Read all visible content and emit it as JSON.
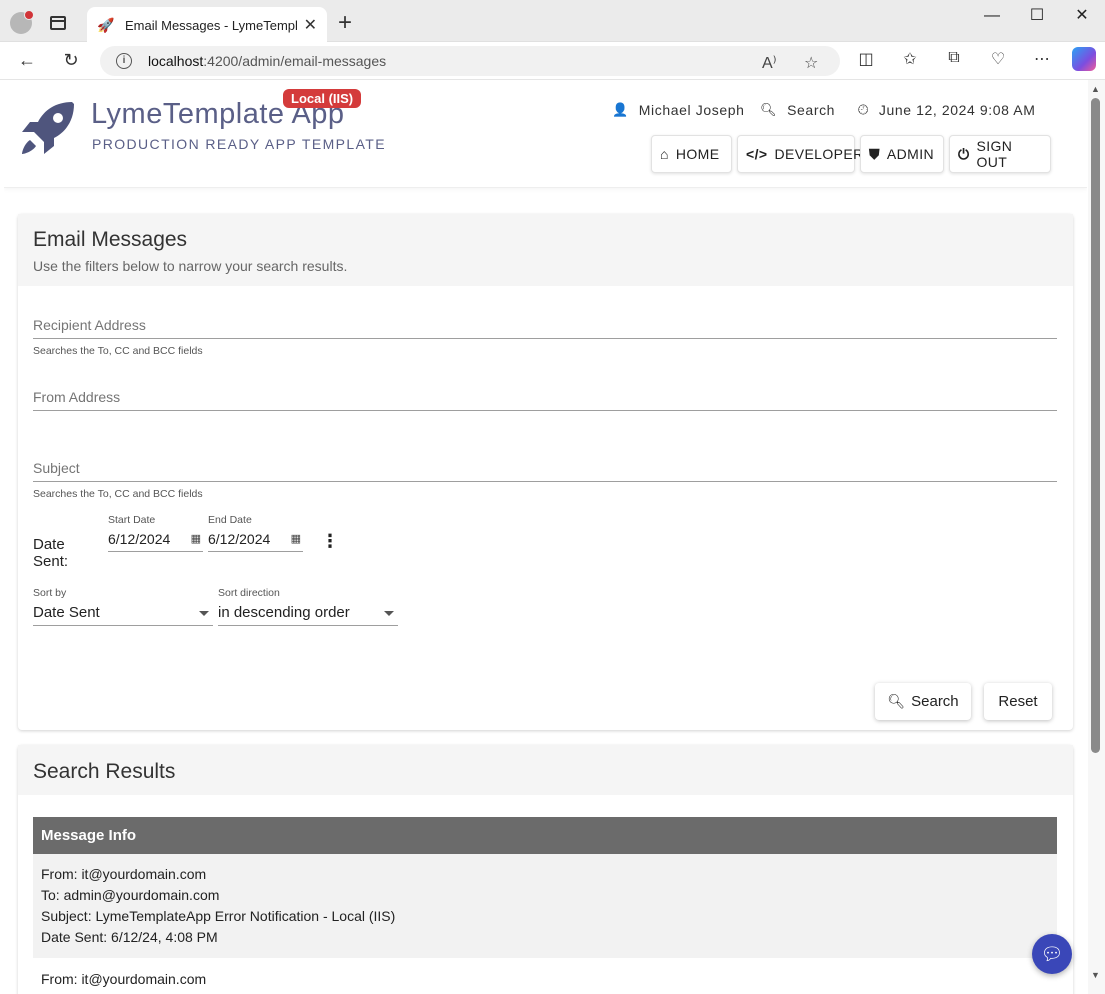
{
  "browser": {
    "tab_title": "Email Messages - LymeTemplate",
    "tab_close": "✕",
    "new_tab": "+",
    "url_host": "localhost",
    "url_path": ":4200/admin/email-messages",
    "window_controls": {
      "minimize": "—",
      "maximize": "☐",
      "close": "✕"
    }
  },
  "header": {
    "app_title": "LymeTemplate App",
    "app_subtitle": "PRODUCTION READY APP TEMPLATE",
    "env_badge": "Local (IIS)",
    "user_name": "Michael Joseph",
    "search_label": "Search",
    "datetime": "June 12, 2024 9:08 AM",
    "nav": {
      "home": "HOME",
      "developer": "DEVELOPER",
      "admin": "ADMIN",
      "sign_out": "SIGN OUT"
    }
  },
  "filters": {
    "title": "Email Messages",
    "description": "Use the filters below to narrow your search results.",
    "recipient_label": "Recipient Address",
    "recipient_hint": "Searches the To, CC and BCC fields",
    "from_label": "From Address",
    "subject_label": "Subject",
    "subject_hint": "Searches the To, CC and BCC fields",
    "date_sent_label": "Date Sent:",
    "start_date_label": "Start Date",
    "start_date_value": "6/12/2024",
    "end_date_label": "End Date",
    "end_date_value": "6/12/2024",
    "sort_by_label": "Sort by",
    "sort_by_value": "Date Sent",
    "sort_dir_label": "Sort direction",
    "sort_dir_value": "in descending order",
    "search_button": "Search",
    "reset_button": "Reset"
  },
  "results": {
    "title": "Search Results",
    "column_header": "Message Info",
    "rows": [
      {
        "from": "From: it@yourdomain.com",
        "to": "To: admin@yourdomain.com",
        "subject": "Subject: LymeTemplateApp Error Notification - Local (IIS)",
        "date": "Date Sent: 6/12/24, 4:08 PM"
      },
      {
        "from": "From: it@yourdomain.com"
      }
    ]
  },
  "colors": {
    "brand": "#5a5f87",
    "badge": "#d43b3b",
    "table_header": "#6b6b6b",
    "chat_fab": "#3a47b8"
  },
  "icons": [
    "rocket-icon",
    "user-icon",
    "search-icon",
    "clock-icon",
    "home-icon",
    "code-icon",
    "shield-icon",
    "power-icon",
    "calendar-icon",
    "kebab-icon",
    "chat-icon"
  ]
}
